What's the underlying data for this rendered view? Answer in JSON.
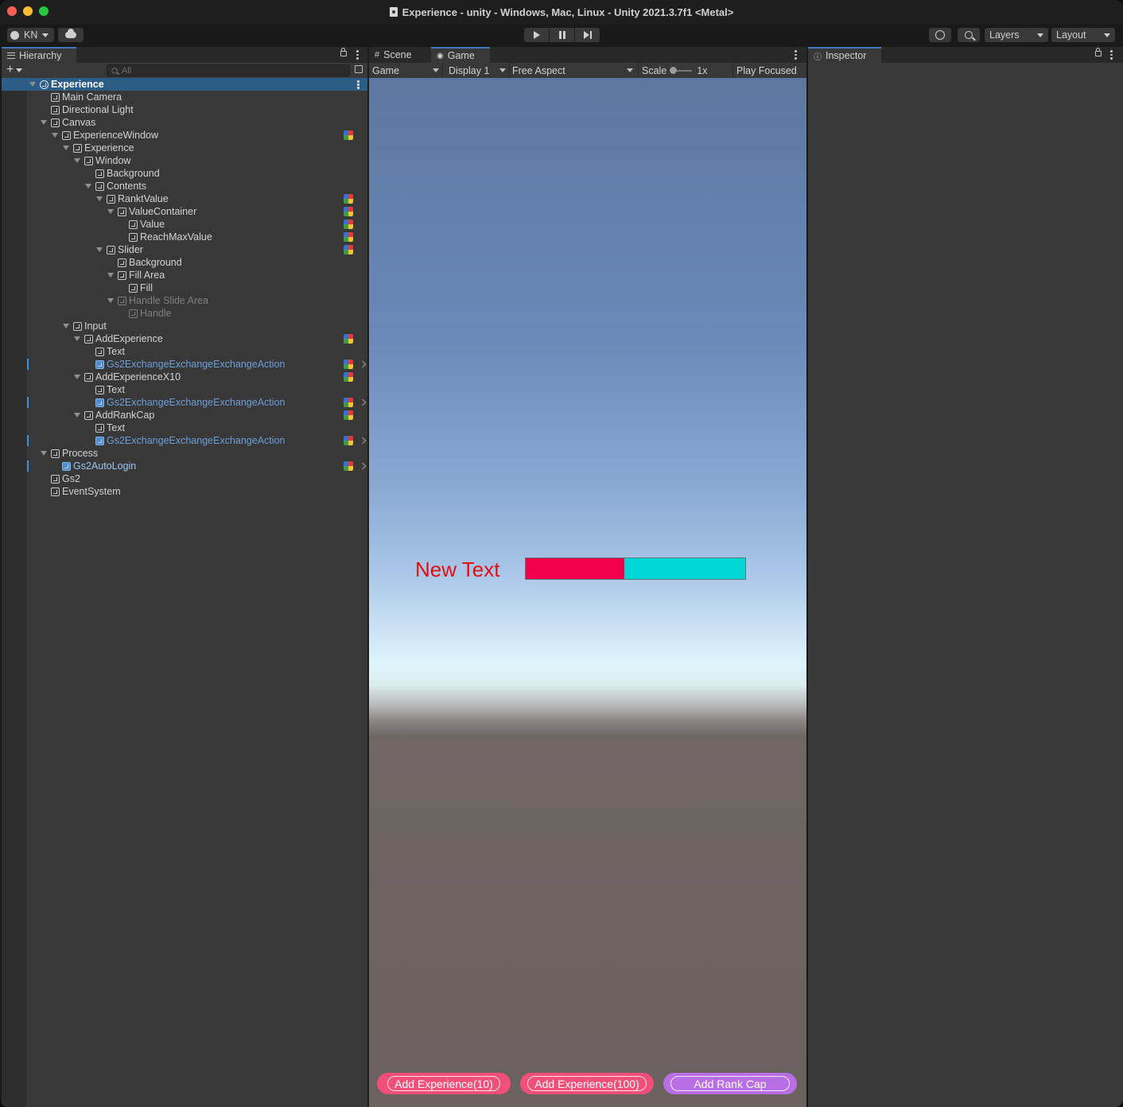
{
  "window": {
    "title": "Experience - unity - Windows, Mac, Linux - Unity 2021.3.7f1 <Metal>"
  },
  "toolbar": {
    "account": "KN",
    "layers": "Layers",
    "layout": "Layout",
    "icons": [
      "account-icon",
      "cloud-icon",
      "play-icon",
      "pause-icon",
      "step-icon",
      "history-icon",
      "search-icon"
    ]
  },
  "hierarchy": {
    "tab": "Hierarchy",
    "search_placeholder": "All",
    "rows": [
      {
        "label": "Experience",
        "depth": 0,
        "expanded": true,
        "selected": true,
        "kind": "scene"
      },
      {
        "label": "Main Camera",
        "depth": 1,
        "kind": "go"
      },
      {
        "label": "Directional Light",
        "depth": 1,
        "kind": "go"
      },
      {
        "label": "Canvas",
        "depth": 1,
        "expanded": true,
        "kind": "go"
      },
      {
        "label": "ExperienceWindow",
        "depth": 2,
        "expanded": true,
        "kind": "go",
        "gem": true
      },
      {
        "label": "Experience",
        "depth": 3,
        "expanded": true,
        "kind": "go"
      },
      {
        "label": "Window",
        "depth": 4,
        "expanded": true,
        "kind": "go"
      },
      {
        "label": "Background",
        "depth": 5,
        "kind": "go"
      },
      {
        "label": "Contents",
        "depth": 5,
        "expanded": true,
        "kind": "go"
      },
      {
        "label": "RanktValue",
        "depth": 6,
        "expanded": true,
        "kind": "go",
        "gem": true
      },
      {
        "label": "ValueContainer",
        "depth": 7,
        "expanded": true,
        "kind": "go",
        "gem": true
      },
      {
        "label": "Value",
        "depth": 8,
        "kind": "go",
        "gem": true
      },
      {
        "label": "ReachMaxValue",
        "depth": 8,
        "kind": "go",
        "gem": true
      },
      {
        "label": "Slider",
        "depth": 6,
        "expanded": true,
        "kind": "go",
        "gem": true
      },
      {
        "label": "Background",
        "depth": 7,
        "kind": "go"
      },
      {
        "label": "Fill Area",
        "depth": 7,
        "expanded": true,
        "kind": "go"
      },
      {
        "label": "Fill",
        "depth": 8,
        "kind": "go"
      },
      {
        "label": "Handle Slide Area",
        "depth": 7,
        "expanded": true,
        "kind": "go",
        "dim": true
      },
      {
        "label": "Handle",
        "depth": 8,
        "kind": "go",
        "dim": true
      },
      {
        "label": "Input",
        "depth": 3,
        "expanded": true,
        "kind": "go"
      },
      {
        "label": "AddExperience",
        "depth": 4,
        "expanded": true,
        "kind": "go",
        "gem": true
      },
      {
        "label": "Text",
        "depth": 5,
        "kind": "go"
      },
      {
        "label": "Gs2ExchangeExchangeExchangeAction",
        "depth": 5,
        "kind": "prefab",
        "gem": true,
        "chevron": true
      },
      {
        "label": "AddExperienceX10",
        "depth": 4,
        "expanded": true,
        "kind": "go",
        "gem": true
      },
      {
        "label": "Text",
        "depth": 5,
        "kind": "go"
      },
      {
        "label": "Gs2ExchangeExchangeExchangeAction",
        "depth": 5,
        "kind": "prefab",
        "gem": true,
        "chevron": true
      },
      {
        "label": "AddRankCap",
        "depth": 4,
        "expanded": true,
        "kind": "go",
        "gem": true
      },
      {
        "label": "Text",
        "depth": 5,
        "kind": "go"
      },
      {
        "label": "Gs2ExchangeExchangeExchangeAction",
        "depth": 5,
        "kind": "prefab",
        "gem": true,
        "chevron": true
      },
      {
        "label": "Process",
        "depth": 1,
        "expanded": true,
        "kind": "go"
      },
      {
        "label": "Gs2AutoLogin",
        "depth": 2,
        "kind": "prefab",
        "light": true,
        "gem": true,
        "chevron": true
      },
      {
        "label": "Gs2",
        "depth": 1,
        "kind": "go"
      },
      {
        "label": "EventSystem",
        "depth": 1,
        "kind": "go"
      }
    ]
  },
  "game": {
    "tabs": [
      "Scene",
      "Game"
    ],
    "active_tab": "Game",
    "mode": "Game",
    "display": "Display 1",
    "aspect": "Free Aspect",
    "scale_label": "Scale",
    "scale_value": "1x",
    "play_mode": "Play Focused",
    "content": {
      "text": "New Text",
      "slider_fill": 0.45,
      "slider_fill_color": "#f2004c",
      "slider_bg_color": "#00d6d6",
      "buttons": [
        "Add Experience(10)",
        "Add Experience(100)",
        "Add Rank Cap"
      ]
    }
  },
  "inspector": {
    "tab": "Inspector"
  }
}
